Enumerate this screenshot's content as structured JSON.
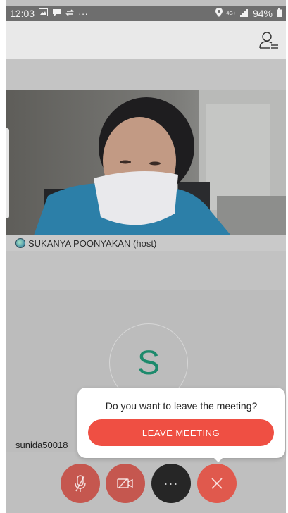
{
  "status_bar": {
    "time": "12:03",
    "network": "4G+",
    "battery": "94%"
  },
  "video": {
    "host_name": "SUKANYA POONYAKAN (host)"
  },
  "participant": {
    "initial": "S",
    "name": "sunida50018"
  },
  "leave_dialog": {
    "question": "Do you want to leave the meeting?",
    "button_label": "LEAVE MEETING"
  },
  "controls": {
    "more_label": "···"
  },
  "colors": {
    "leave_red": "#ef4f43",
    "avatar_green": "#1d8a6c"
  },
  "icons": [
    "image-icon",
    "chat-icon",
    "sync-icon",
    "more-dots-icon",
    "location-icon",
    "signal-icon",
    "battery-icon",
    "participants-icon",
    "mic-off-icon",
    "camera-off-icon",
    "close-icon"
  ]
}
